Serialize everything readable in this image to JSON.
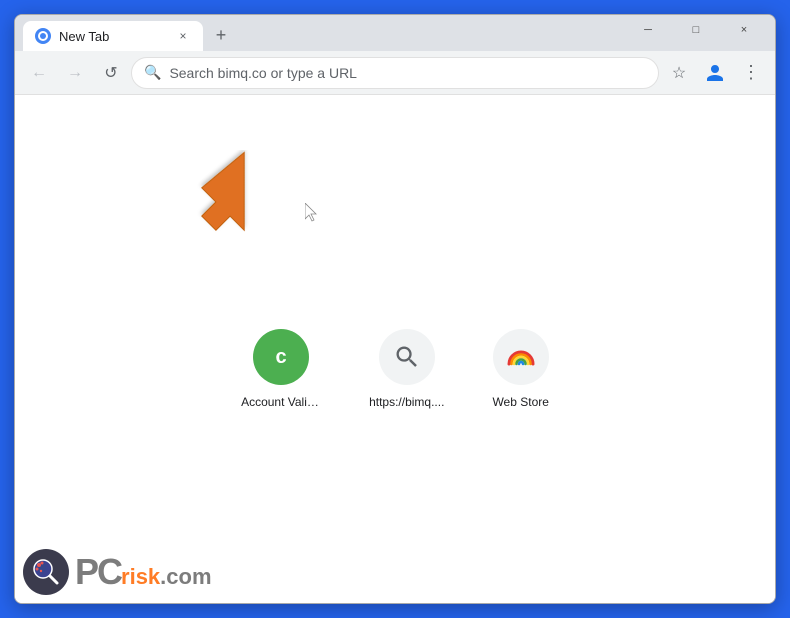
{
  "browser": {
    "title": "New Tab",
    "tab_close": "×",
    "new_tab": "+",
    "window_controls": {
      "minimize": "─",
      "maximize": "□",
      "close": "×"
    },
    "nav": {
      "back": "←",
      "forward": "→",
      "reload": "↺",
      "address_placeholder": "Search bimq.co or type a URL",
      "bookmark": "☆",
      "profile": "👤",
      "menu": "⋮"
    }
  },
  "shortcuts": [
    {
      "id": "account-valid",
      "label": "Account Valid...",
      "icon_letter": "c",
      "icon_type": "letter"
    },
    {
      "id": "bimq",
      "label": "https://bimq....",
      "icon_type": "search"
    },
    {
      "id": "web-store",
      "label": "Web Store",
      "icon_type": "webstore"
    }
  ],
  "watermark": {
    "pc": "PC",
    "risk": "risk",
    "dot_com": ".com"
  }
}
